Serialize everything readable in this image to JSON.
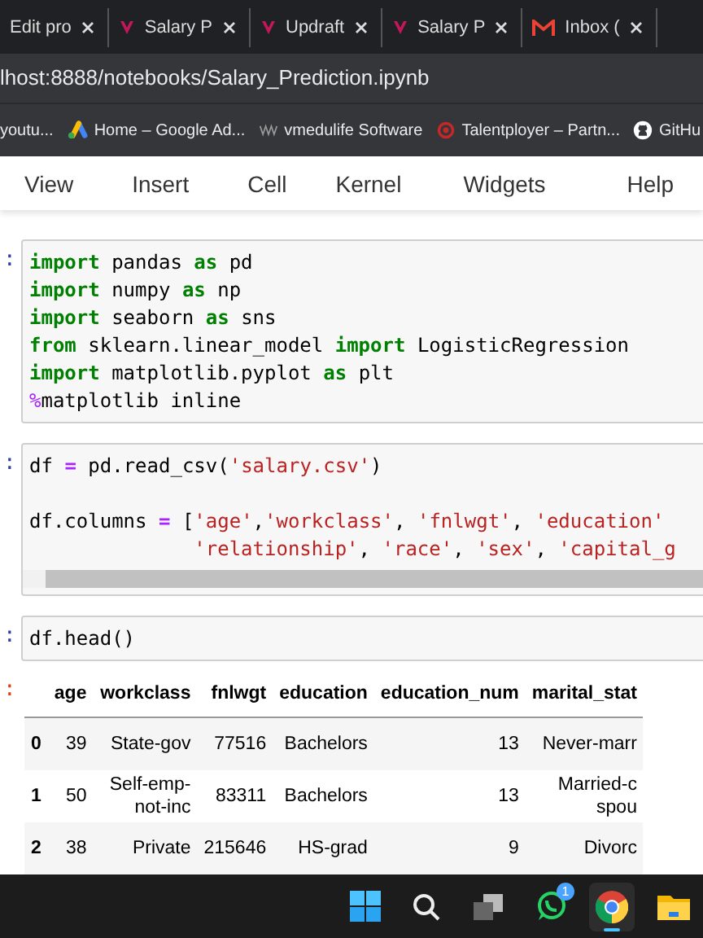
{
  "browser_tabs": [
    {
      "title": "Edit pro"
    },
    {
      "title": "Salary P"
    },
    {
      "title": "Updraft"
    },
    {
      "title": "Salary P"
    },
    {
      "title": "Inbox ("
    }
  ],
  "address_bar": {
    "url": "lhost:8888/notebooks/Salary_Prediction.ipynb"
  },
  "bookmarks": [
    {
      "label": "youtu..."
    },
    {
      "label": "Home – Google Ad..."
    },
    {
      "label": "vmedulife Software"
    },
    {
      "label": "Talentployer – Partn..."
    },
    {
      "label": "GitHu"
    }
  ],
  "menu": [
    "View",
    "Insert",
    "Cell",
    "Kernel",
    "Widgets",
    "Help"
  ],
  "cells": [
    {
      "prompt": ":",
      "scrollbar": false,
      "lines": [
        {
          "tokens": [
            {
              "kind": "keyword",
              "text": "import"
            },
            {
              "kind": "name",
              "text": " pandas "
            },
            {
              "kind": "keyword",
              "text": "as"
            },
            {
              "kind": "name",
              "text": " pd"
            }
          ]
        },
        {
          "tokens": [
            {
              "kind": "keyword",
              "text": "import"
            },
            {
              "kind": "name",
              "text": " numpy "
            },
            {
              "kind": "keyword",
              "text": "as"
            },
            {
              "kind": "name",
              "text": " np"
            }
          ]
        },
        {
          "tokens": [
            {
              "kind": "keyword",
              "text": "import"
            },
            {
              "kind": "name",
              "text": " seaborn "
            },
            {
              "kind": "keyword",
              "text": "as"
            },
            {
              "kind": "name",
              "text": " sns"
            }
          ]
        },
        {
          "tokens": [
            {
              "kind": "keyword",
              "text": "from"
            },
            {
              "kind": "name",
              "text": " sklearn.linear_model "
            },
            {
              "kind": "keyword",
              "text": "import"
            },
            {
              "kind": "name",
              "text": " LogisticRegression"
            }
          ]
        },
        {
          "tokens": [
            {
              "kind": "keyword",
              "text": "import"
            },
            {
              "kind": "name",
              "text": " matplotlib.pyplot "
            },
            {
              "kind": "keyword",
              "text": "as"
            },
            {
              "kind": "name",
              "text": " plt"
            }
          ]
        },
        {
          "tokens": [
            {
              "kind": "magic",
              "text": "%"
            },
            {
              "kind": "name",
              "text": "matplotlib inline"
            }
          ]
        }
      ]
    },
    {
      "prompt": ":",
      "scrollbar": true,
      "lines": [
        {
          "tokens": [
            {
              "kind": "name",
              "text": "df "
            },
            {
              "kind": "operator",
              "text": "="
            },
            {
              "kind": "name",
              "text": " pd.read_csv("
            },
            {
              "kind": "string",
              "text": "'salary.csv'"
            },
            {
              "kind": "name",
              "text": ")"
            }
          ]
        },
        {
          "blank_before": true,
          "tokens": [
            {
              "kind": "name",
              "text": "df.columns "
            },
            {
              "kind": "operator",
              "text": "="
            },
            {
              "kind": "name",
              "text": " ["
            },
            {
              "kind": "string",
              "text": "'age'"
            },
            {
              "kind": "name",
              "text": ","
            },
            {
              "kind": "string",
              "text": "'workclass'"
            },
            {
              "kind": "name",
              "text": ", "
            },
            {
              "kind": "string",
              "text": "'fnlwgt'"
            },
            {
              "kind": "name",
              "text": ", "
            },
            {
              "kind": "string",
              "text": "'education'"
            }
          ]
        },
        {
          "indent": true,
          "tokens": [
            {
              "kind": "string",
              "text": "'relationship'"
            },
            {
              "kind": "name",
              "text": ", "
            },
            {
              "kind": "string",
              "text": "'race'"
            },
            {
              "kind": "name",
              "text": ", "
            },
            {
              "kind": "string",
              "text": "'sex'"
            },
            {
              "kind": "name",
              "text": ", "
            },
            {
              "kind": "string",
              "text": "'capital_g"
            }
          ]
        }
      ]
    },
    {
      "prompt": ":",
      "scrollbar": false,
      "lines": [
        {
          "tokens": [
            {
              "kind": "name",
              "text": "df.head()"
            }
          ]
        }
      ]
    }
  ],
  "output": {
    "prompt": ":",
    "table": {
      "columns": [
        "",
        "age",
        "workclass",
        "fnlwgt",
        "education",
        "education_num",
        "marital_stat"
      ],
      "rows": [
        [
          "0",
          "39",
          "State-gov",
          "77516",
          "Bachelors",
          "13",
          "Never-marr"
        ],
        [
          "1",
          "50",
          "Self-emp-not-inc",
          "83311",
          "Bachelors",
          "13",
          "Married-c\nspou"
        ],
        [
          "2",
          "38",
          "Private",
          "215646",
          "HS-grad",
          "9",
          "Divorc"
        ]
      ]
    }
  },
  "taskbar": [
    {
      "active": false
    },
    {
      "active": false
    },
    {
      "active": false
    },
    {
      "active": false,
      "badge": "1"
    },
    {
      "active": true
    },
    {
      "active": false
    }
  ]
}
